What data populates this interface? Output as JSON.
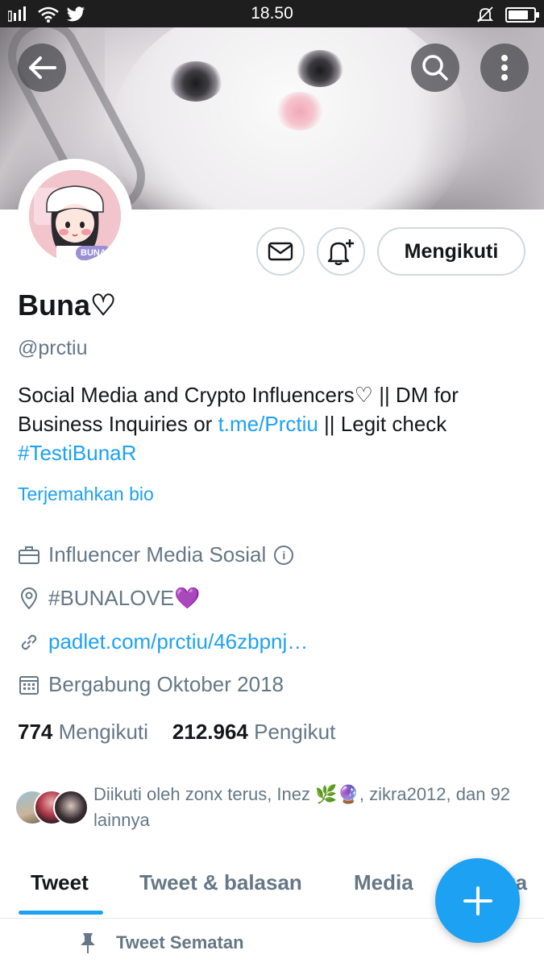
{
  "status_bar": {
    "time": "18.50",
    "battery_level": 0.8,
    "icons": [
      "signal-icon",
      "wifi-icon",
      "twitter-icon",
      "mute-icon",
      "battery-icon"
    ]
  },
  "profile": {
    "display_name": "Buna♡",
    "handle": "@prctiu",
    "avatar_badge": "BUNA",
    "bio_text_1": "Social Media and Crypto Influencers♡ || DM for Business Inquiries or ",
    "bio_link": "t.me/Prctiu",
    "bio_text_2": " || Legit check ",
    "bio_hashtag": "#TestiBunaR",
    "translate_label": "Terjemahkan bio",
    "category": "Influencer Media Sosial",
    "location": "#BUNALOVE💜",
    "website": "padlet.com/prctiu/46zbpnj…",
    "joined": "Bergabung Oktober 2018",
    "following_count": "774",
    "following_label": "Mengikuti",
    "followers_count": "212.964",
    "followers_label": "Pengikut",
    "followed_by": "Diikuti oleh zonx terus, Inez 🌿🔮, zikra2012, dan 92 lainnya"
  },
  "actions": {
    "follow_label": "Mengikuti"
  },
  "tabs": [
    {
      "label": "Tweet",
      "active": true
    },
    {
      "label": "Tweet & balasan",
      "active": false
    },
    {
      "label": "Media",
      "active": false
    },
    {
      "label": "Suka",
      "active": false
    }
  ],
  "pinned_label": "Tweet Sematan",
  "colors": {
    "accent": "#1da1f2",
    "text_primary": "#14171a",
    "text_secondary": "#657786",
    "border": "#cfd9de"
  }
}
